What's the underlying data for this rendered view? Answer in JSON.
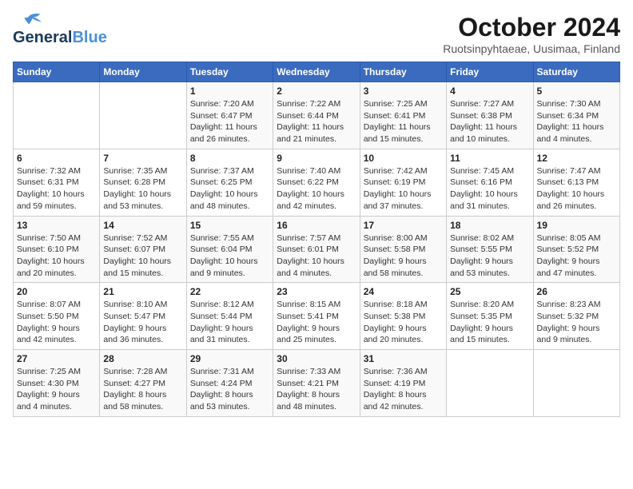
{
  "logo": {
    "text_general": "General",
    "text_blue": "Blue"
  },
  "title": "October 2024",
  "subtitle": "Ruotsinpyhtaeae, Uusimaa, Finland",
  "weekdays": [
    "Sunday",
    "Monday",
    "Tuesday",
    "Wednesday",
    "Thursday",
    "Friday",
    "Saturday"
  ],
  "weeks": [
    [
      {
        "day": "",
        "info": ""
      },
      {
        "day": "",
        "info": ""
      },
      {
        "day": "1",
        "info": "Sunrise: 7:20 AM\nSunset: 6:47 PM\nDaylight: 11 hours\nand 26 minutes."
      },
      {
        "day": "2",
        "info": "Sunrise: 7:22 AM\nSunset: 6:44 PM\nDaylight: 11 hours\nand 21 minutes."
      },
      {
        "day": "3",
        "info": "Sunrise: 7:25 AM\nSunset: 6:41 PM\nDaylight: 11 hours\nand 15 minutes."
      },
      {
        "day": "4",
        "info": "Sunrise: 7:27 AM\nSunset: 6:38 PM\nDaylight: 11 hours\nand 10 minutes."
      },
      {
        "day": "5",
        "info": "Sunrise: 7:30 AM\nSunset: 6:34 PM\nDaylight: 11 hours\nand 4 minutes."
      }
    ],
    [
      {
        "day": "6",
        "info": "Sunrise: 7:32 AM\nSunset: 6:31 PM\nDaylight: 10 hours\nand 59 minutes."
      },
      {
        "day": "7",
        "info": "Sunrise: 7:35 AM\nSunset: 6:28 PM\nDaylight: 10 hours\nand 53 minutes."
      },
      {
        "day": "8",
        "info": "Sunrise: 7:37 AM\nSunset: 6:25 PM\nDaylight: 10 hours\nand 48 minutes."
      },
      {
        "day": "9",
        "info": "Sunrise: 7:40 AM\nSunset: 6:22 PM\nDaylight: 10 hours\nand 42 minutes."
      },
      {
        "day": "10",
        "info": "Sunrise: 7:42 AM\nSunset: 6:19 PM\nDaylight: 10 hours\nand 37 minutes."
      },
      {
        "day": "11",
        "info": "Sunrise: 7:45 AM\nSunset: 6:16 PM\nDaylight: 10 hours\nand 31 minutes."
      },
      {
        "day": "12",
        "info": "Sunrise: 7:47 AM\nSunset: 6:13 PM\nDaylight: 10 hours\nand 26 minutes."
      }
    ],
    [
      {
        "day": "13",
        "info": "Sunrise: 7:50 AM\nSunset: 6:10 PM\nDaylight: 10 hours\nand 20 minutes."
      },
      {
        "day": "14",
        "info": "Sunrise: 7:52 AM\nSunset: 6:07 PM\nDaylight: 10 hours\nand 15 minutes."
      },
      {
        "day": "15",
        "info": "Sunrise: 7:55 AM\nSunset: 6:04 PM\nDaylight: 10 hours\nand 9 minutes."
      },
      {
        "day": "16",
        "info": "Sunrise: 7:57 AM\nSunset: 6:01 PM\nDaylight: 10 hours\nand 4 minutes."
      },
      {
        "day": "17",
        "info": "Sunrise: 8:00 AM\nSunset: 5:58 PM\nDaylight: 9 hours\nand 58 minutes."
      },
      {
        "day": "18",
        "info": "Sunrise: 8:02 AM\nSunset: 5:55 PM\nDaylight: 9 hours\nand 53 minutes."
      },
      {
        "day": "19",
        "info": "Sunrise: 8:05 AM\nSunset: 5:52 PM\nDaylight: 9 hours\nand 47 minutes."
      }
    ],
    [
      {
        "day": "20",
        "info": "Sunrise: 8:07 AM\nSunset: 5:50 PM\nDaylight: 9 hours\nand 42 minutes."
      },
      {
        "day": "21",
        "info": "Sunrise: 8:10 AM\nSunset: 5:47 PM\nDaylight: 9 hours\nand 36 minutes."
      },
      {
        "day": "22",
        "info": "Sunrise: 8:12 AM\nSunset: 5:44 PM\nDaylight: 9 hours\nand 31 minutes."
      },
      {
        "day": "23",
        "info": "Sunrise: 8:15 AM\nSunset: 5:41 PM\nDaylight: 9 hours\nand 25 minutes."
      },
      {
        "day": "24",
        "info": "Sunrise: 8:18 AM\nSunset: 5:38 PM\nDaylight: 9 hours\nand 20 minutes."
      },
      {
        "day": "25",
        "info": "Sunrise: 8:20 AM\nSunset: 5:35 PM\nDaylight: 9 hours\nand 15 minutes."
      },
      {
        "day": "26",
        "info": "Sunrise: 8:23 AM\nSunset: 5:32 PM\nDaylight: 9 hours\nand 9 minutes."
      }
    ],
    [
      {
        "day": "27",
        "info": "Sunrise: 7:25 AM\nSunset: 4:30 PM\nDaylight: 9 hours\nand 4 minutes."
      },
      {
        "day": "28",
        "info": "Sunrise: 7:28 AM\nSunset: 4:27 PM\nDaylight: 8 hours\nand 58 minutes."
      },
      {
        "day": "29",
        "info": "Sunrise: 7:31 AM\nSunset: 4:24 PM\nDaylight: 8 hours\nand 53 minutes."
      },
      {
        "day": "30",
        "info": "Sunrise: 7:33 AM\nSunset: 4:21 PM\nDaylight: 8 hours\nand 48 minutes."
      },
      {
        "day": "31",
        "info": "Sunrise: 7:36 AM\nSunset: 4:19 PM\nDaylight: 8 hours\nand 42 minutes."
      },
      {
        "day": "",
        "info": ""
      },
      {
        "day": "",
        "info": ""
      }
    ]
  ]
}
